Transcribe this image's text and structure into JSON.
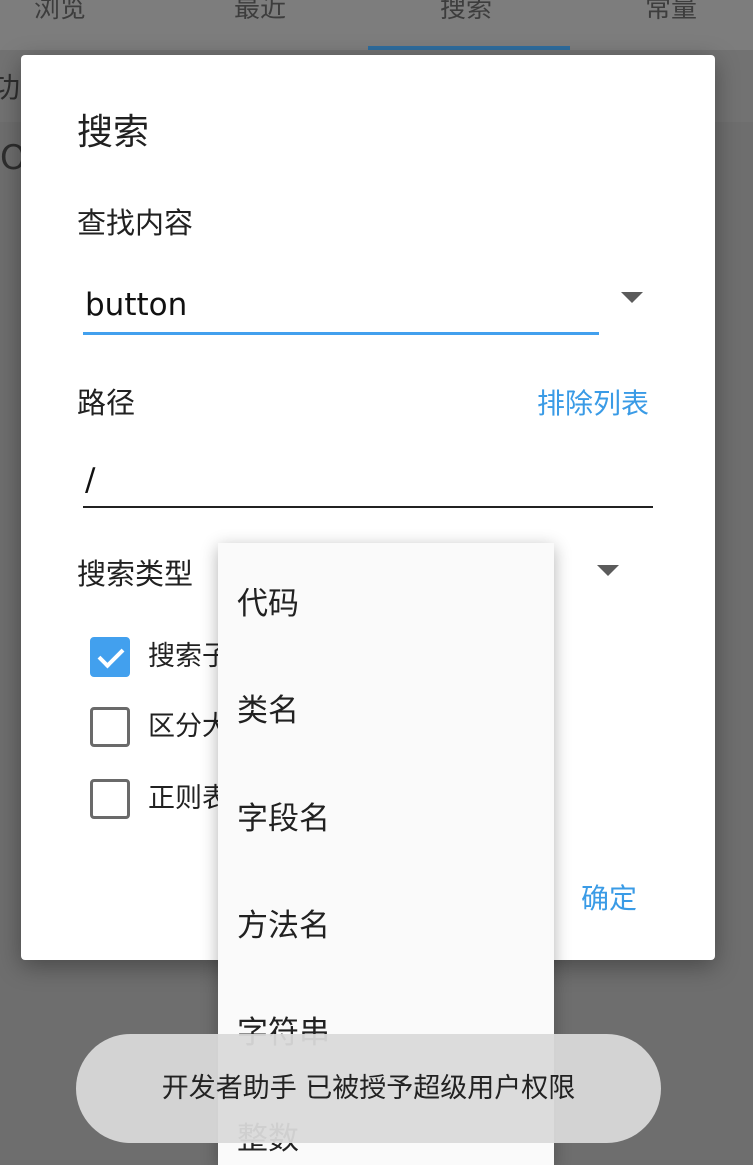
{
  "background": {
    "tabs": [
      {
        "label": "浏览"
      },
      {
        "label": "最近"
      },
      {
        "label": "搜索"
      },
      {
        "label": "常量"
      }
    ],
    "fragment_left": "功",
    "fragment_circle": "O"
  },
  "dialog": {
    "title": "搜索",
    "find_label": "查找内容",
    "find_value": "button",
    "path_label": "路径",
    "exclude_link": "排除列表",
    "path_value": "/",
    "type_label": "搜索类型",
    "checkboxes": [
      {
        "label": "搜索子",
        "checked": true
      },
      {
        "label": "区分大",
        "checked": false
      },
      {
        "label": "正则表",
        "checked": false
      }
    ],
    "ok_label": "确定"
  },
  "type_menu": {
    "items": [
      {
        "label": "代码"
      },
      {
        "label": "类名"
      },
      {
        "label": "字段名"
      },
      {
        "label": "方法名"
      },
      {
        "label": "字符串"
      },
      {
        "label": "整数"
      }
    ]
  },
  "toast": {
    "message": "开发者助手 已被授予超级用户权限"
  },
  "colors": {
    "accent": "#42a0ee",
    "link": "#3a9be6",
    "scrim": "#6e6e6e"
  }
}
